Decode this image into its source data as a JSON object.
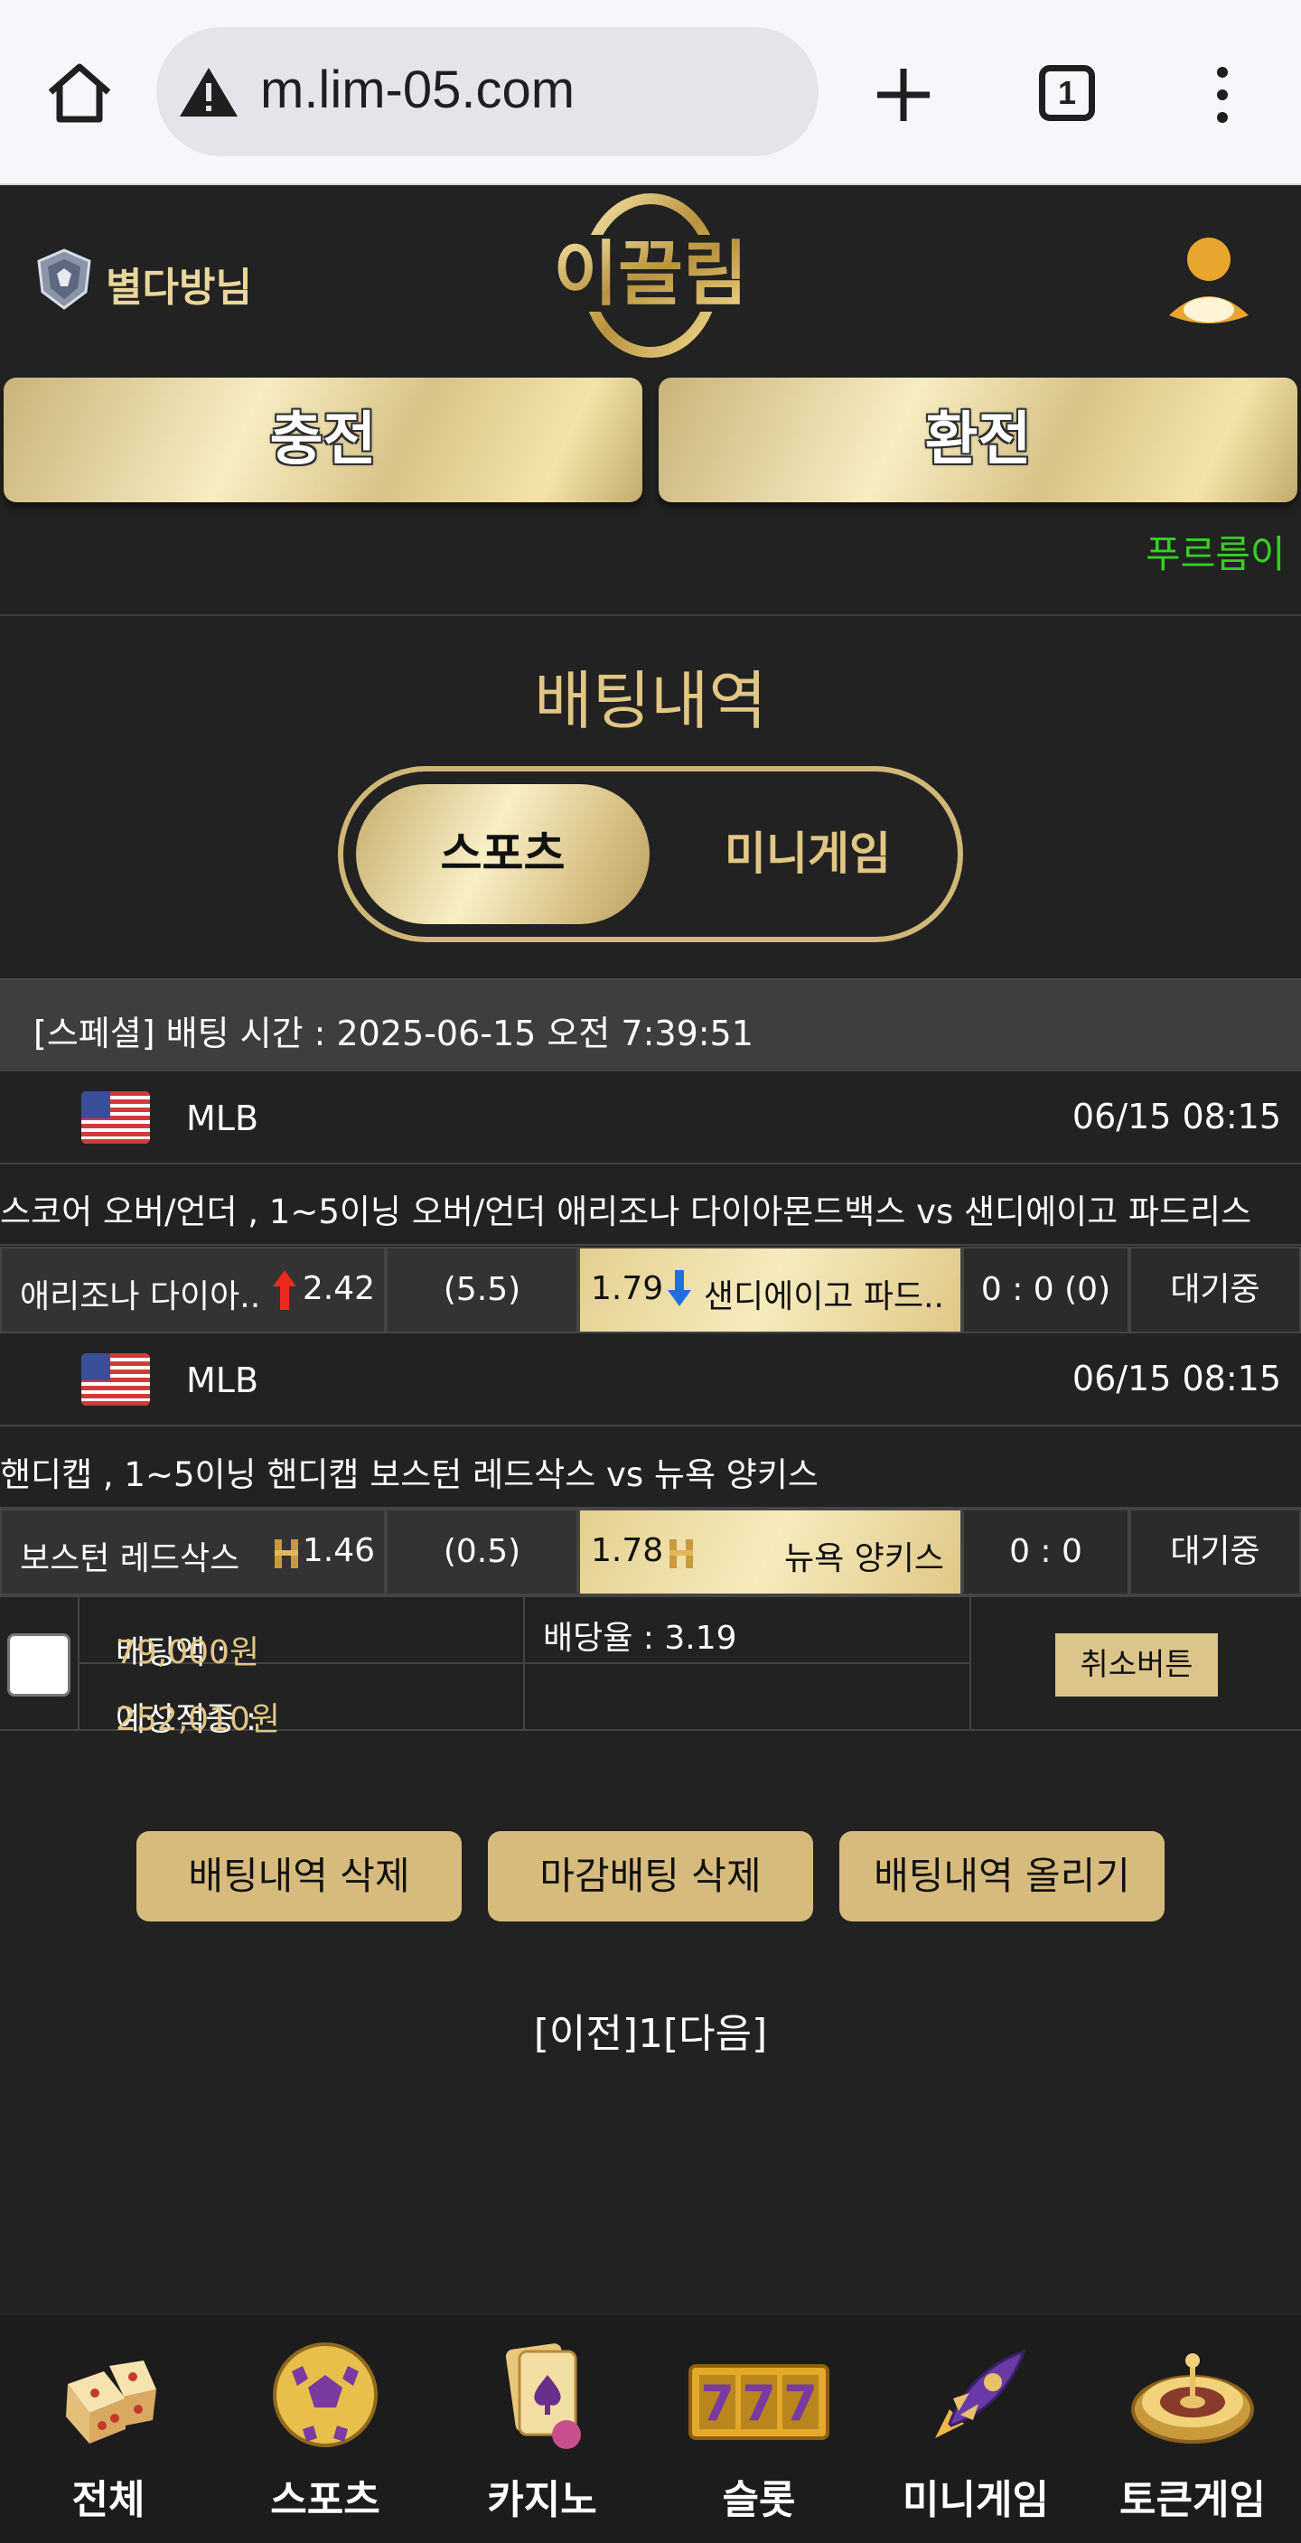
{
  "browser": {
    "url": "m.lim-05.com",
    "tab_count": "1"
  },
  "header": {
    "user_name": "별다방님",
    "logo_text": "이끌림"
  },
  "cash_buttons": {
    "deposit": "충전",
    "withdraw": "환전"
  },
  "marquee": "푸르름이 ",
  "page_title": "배팅내역",
  "segment": {
    "sports": "스포츠",
    "minigame": "미니게임",
    "active": "sports"
  },
  "bet": {
    "header": "[스페셜] 배팅 시간 : 2025-06-15 오전 7:39:51",
    "games": [
      {
        "league": "MLB",
        "time": "06/15 08:15",
        "market": "스코어 오버/언더 , 1~5이닝 오버/언더 애리조나 다이아몬드백스  vs  샌디에이고 파드리스",
        "home_team": "애리조나 다이아..",
        "home_odd": "2.42",
        "line": "(5.5)",
        "away_odd": "1.79",
        "away_team": "샌디에이고 파드..",
        "score": "0 : 0 (0)",
        "status": "대기중"
      },
      {
        "league": "MLB",
        "time": "06/15 08:15",
        "market": "핸디캡 , 1~5이닝 핸디캡 보스턴 레드삭스  vs  뉴욕 양키스",
        "home_team": "보스턴 레드삭스",
        "home_odd": "1.46",
        "line": "(0.5)",
        "away_odd": "1.78",
        "away_team": "뉴욕 양키스",
        "score": "0 : 0",
        "status": "대기중"
      }
    ],
    "summary": {
      "amount_label": "배팅액 : ",
      "amount_value": "79,000원",
      "rate_label": "배당율 : 3.19",
      "expected_label": "예상적중 : ",
      "expected_value": "252,010원",
      "cancel": "취소버튼"
    }
  },
  "actions": {
    "delete_history": "배팅내역 삭제",
    "delete_closed": "마감배팅 삭제",
    "upload_history": "배팅내역 올리기"
  },
  "pager": "[이전]1[다음]",
  "bottom_nav": [
    {
      "label": "전체",
      "icon": "dice-icon"
    },
    {
      "label": "스포츠",
      "icon": "soccer-ball-icon"
    },
    {
      "label": "카지노",
      "icon": "cards-icon"
    },
    {
      "label": "슬롯",
      "icon": "slot-777-icon"
    },
    {
      "label": "미니게임",
      "icon": "rocket-icon"
    },
    {
      "label": "토큰게임",
      "icon": "roulette-icon"
    }
  ],
  "colors": {
    "background": "#222222",
    "gold": "#e2c685",
    "marquee_green": "#35d024"
  }
}
